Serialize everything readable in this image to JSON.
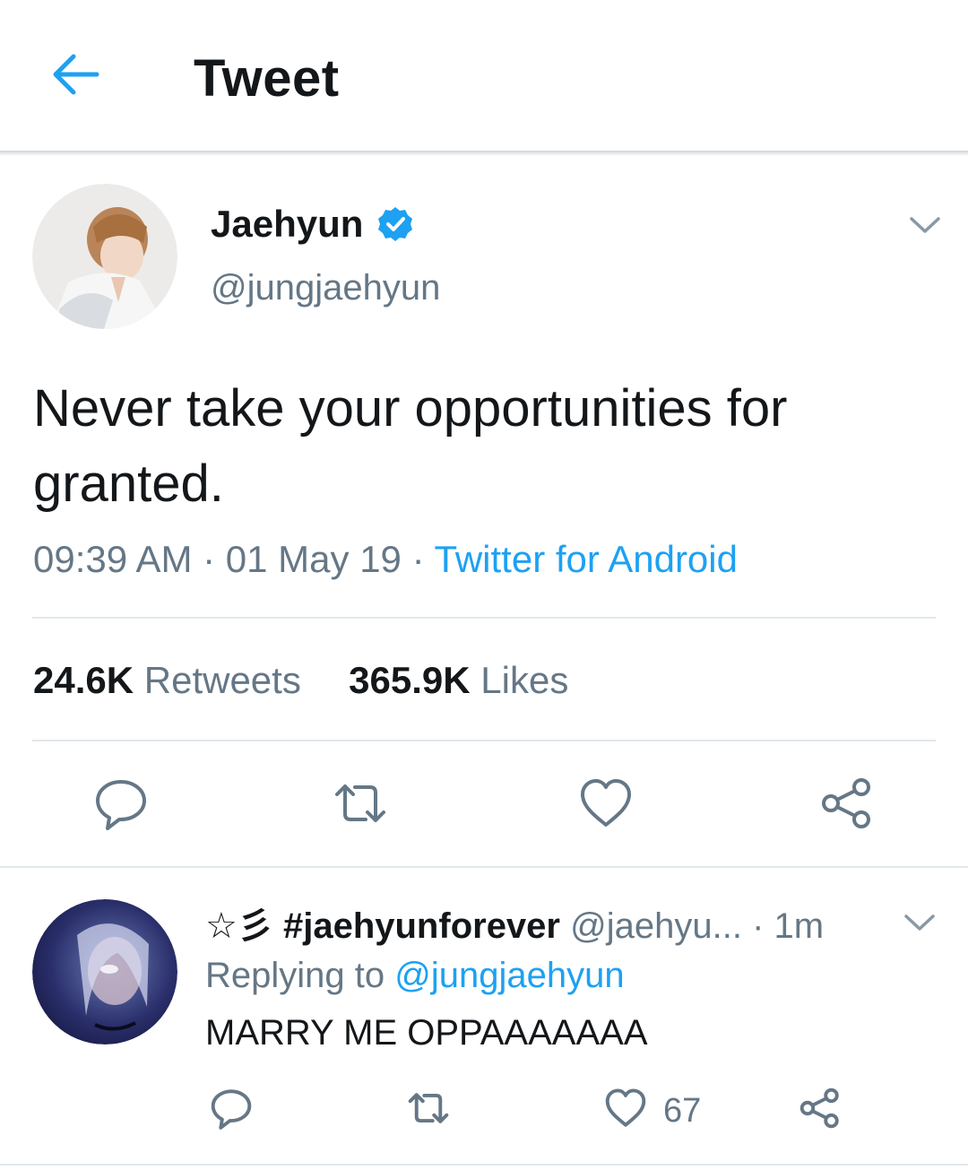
{
  "header": {
    "title": "Tweet"
  },
  "tweet": {
    "display_name": "Jaehyun",
    "handle": "@jungjaehyun",
    "text": "Never take your opportunities for granted.",
    "time": "09:39 AM",
    "sep1": " · ",
    "date": "01 May 19",
    "sep2": " · ",
    "source": "Twitter for Android",
    "retweets_count": "24.6K",
    "retweets_label": "Retweets",
    "likes_count": "365.9K",
    "likes_label": "Likes"
  },
  "reply": {
    "name": "☆彡 #jaehyunforever",
    "handle": "@jaehyu...",
    "time_sep": " · ",
    "time": "1m",
    "replying_prefix": "Replying to ",
    "replying_to": "@jungjaehyun",
    "text": "MARRY ME OPPAAAAAAA",
    "like_count": "67"
  },
  "colors": {
    "accent": "#1da1f2",
    "text": "#14171a",
    "secondary": "#657786",
    "divider": "#e1e8ed"
  },
  "icons": [
    "back-arrow-icon",
    "verified-badge-icon",
    "chevron-down-icon",
    "reply-icon",
    "retweet-icon",
    "like-heart-icon",
    "share-icon"
  ]
}
